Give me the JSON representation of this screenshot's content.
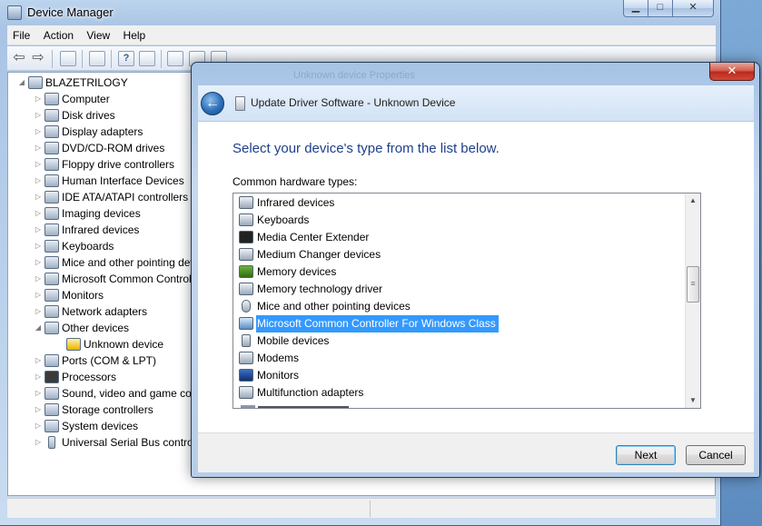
{
  "device_manager": {
    "title": "Device Manager",
    "caption_buttons": {
      "minimize": "▁",
      "maximize": "□",
      "close": "✕"
    },
    "menu": [
      "File",
      "Action",
      "View",
      "Help"
    ],
    "toolbar_icons": [
      "back-arrow-icon",
      "forward-arrow-icon",
      "properties-icon",
      "view-icon",
      "help-icon",
      "scan-icon",
      "update-driver-icon",
      "disable-icon",
      "uninstall-icon"
    ],
    "tree": {
      "root": "BLAZETRILOGY",
      "items": [
        "Computer",
        "Disk drives",
        "Display adapters",
        "DVD/CD-ROM drives",
        "Floppy drive controllers",
        "Human Interface Devices",
        "IDE ATA/ATAPI controllers",
        "Imaging devices",
        "Infrared devices",
        "Keyboards",
        "Mice and other pointing devices",
        "Microsoft Common Controller For Windows Class",
        "Monitors",
        "Network adapters",
        "Other devices",
        "Unknown device",
        "Ports (COM & LPT)",
        "Processors",
        "Sound, video and game controllers",
        "Storage controllers",
        "System devices",
        "Universal Serial Bus controllers"
      ]
    }
  },
  "update_driver_dialog": {
    "background_title": "Unknown device Properties",
    "close_glyph": "✕",
    "back_glyph": "←",
    "header_title": "Update Driver Software - Unknown Device",
    "instruction": "Select your device's type from the list below.",
    "list_label": "Common hardware types:",
    "list_items": [
      "Infrared devices",
      "Keyboards",
      "Media Center Extender",
      "Medium Changer devices",
      "Memory devices",
      "Memory technology driver",
      "Mice and other pointing devices",
      "Microsoft Common Controller For Windows Class",
      "Mobile devices",
      "Modems",
      "Monitors",
      "Multifunction adapters"
    ],
    "selected_item": "Microsoft Common Controller For Windows Class",
    "scroll_up": "▲",
    "scroll_down": "▼",
    "scroll_grip": "≡",
    "buttons": {
      "next": "Next",
      "cancel": "Cancel"
    }
  }
}
